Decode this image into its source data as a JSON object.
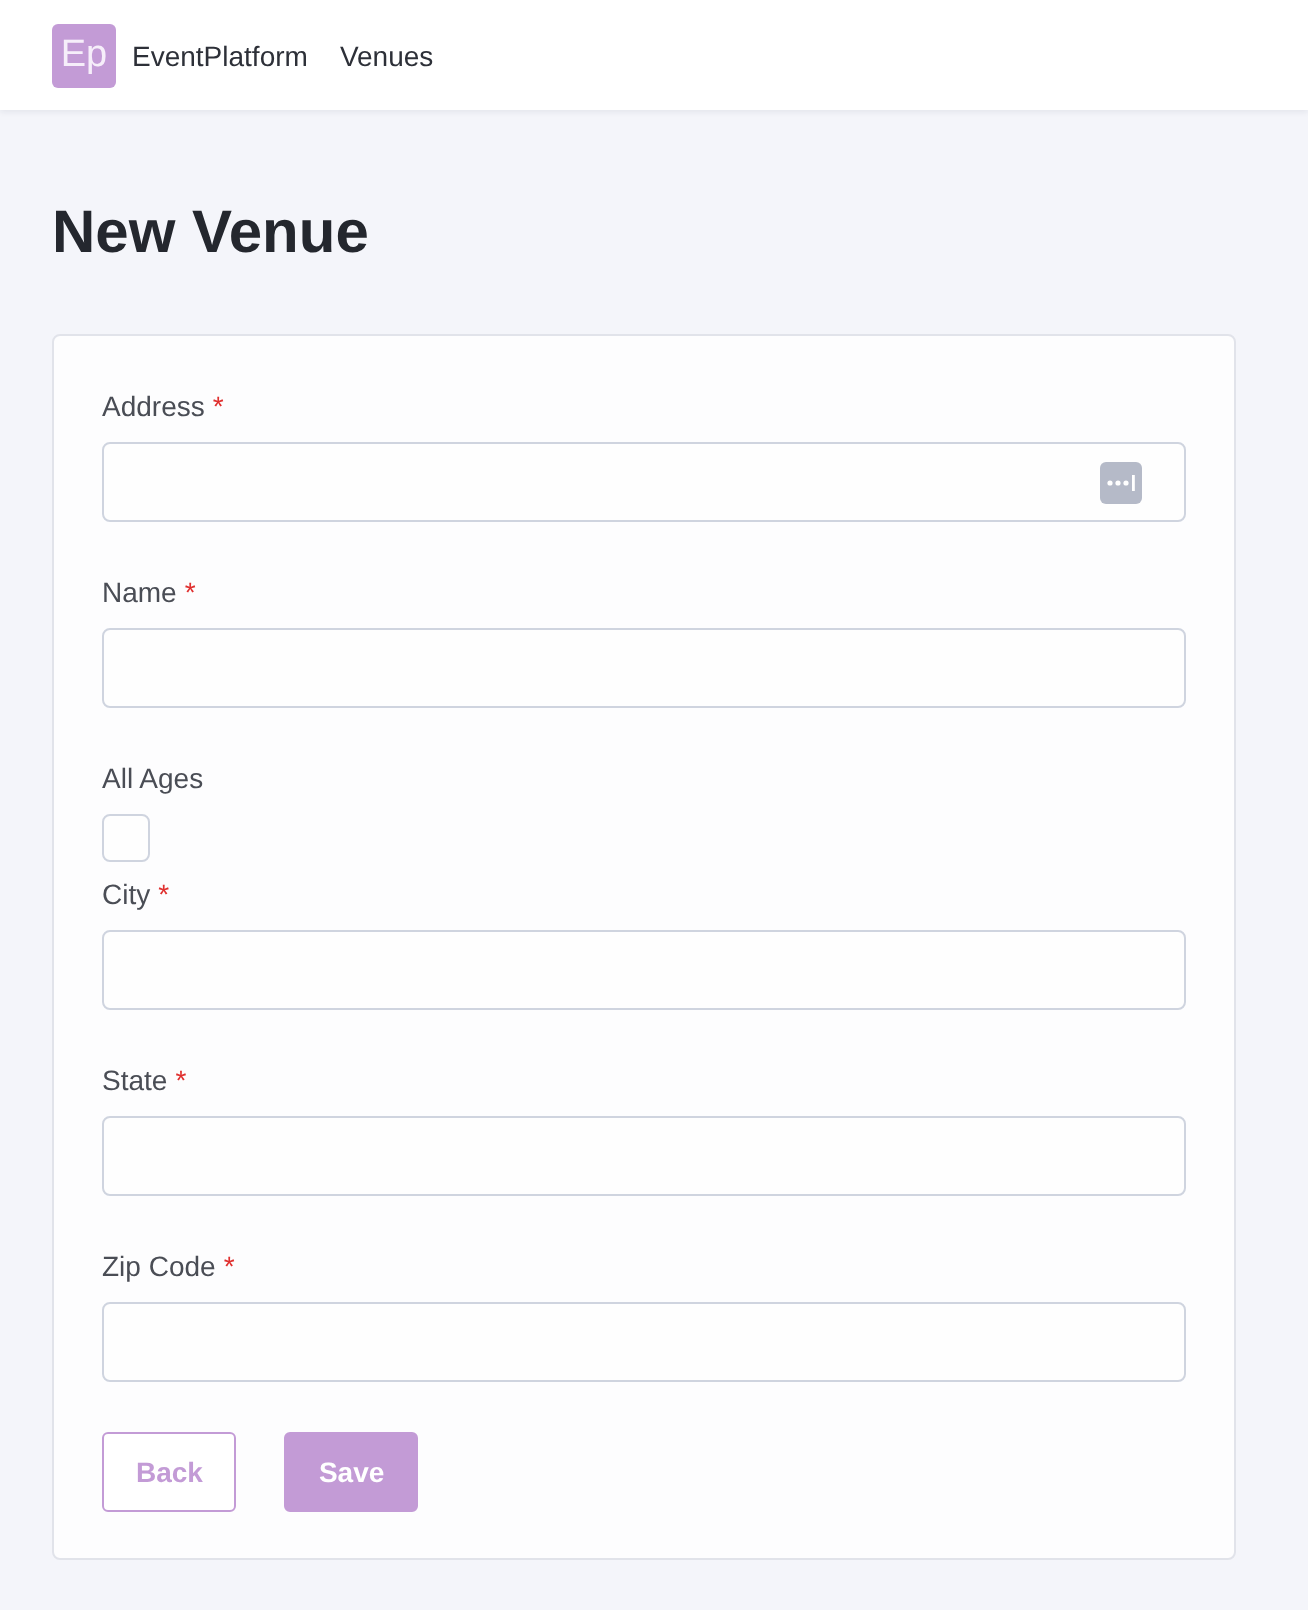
{
  "header": {
    "logo": "Ep",
    "app_name": "EventPlatform",
    "nav": [
      {
        "label": "Venues"
      }
    ]
  },
  "page": {
    "title": "New Venue"
  },
  "form": {
    "fields": [
      {
        "kind": "text_with_menu",
        "label": "Address",
        "marker": "*"
      },
      {
        "kind": "text",
        "label": "Name",
        "marker": "*"
      },
      {
        "kind": "checkbox",
        "label": "All Ages",
        "checked": false
      },
      {
        "kind": "text",
        "label": "City",
        "marker": "*"
      },
      {
        "kind": "text",
        "label": "State",
        "marker": "*"
      },
      {
        "kind": "text",
        "label": "Zip Code",
        "marker": "*"
      }
    ],
    "buttons": [
      {
        "label": "Back",
        "kind": "outline"
      },
      {
        "label": "Save",
        "kind": "primary"
      }
    ]
  }
}
